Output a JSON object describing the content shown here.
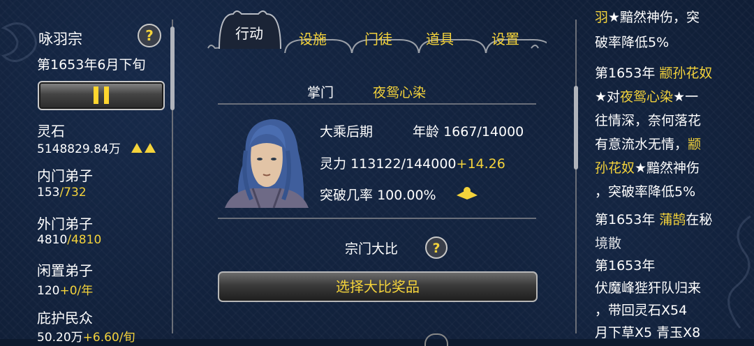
{
  "left_panel": {
    "sect_name": "咏羽宗",
    "date": "第1653年6月下旬",
    "resources": [
      {
        "label": "灵石",
        "value_main": "5148829.84万",
        "value_extra": "",
        "trend": "up-up"
      },
      {
        "label": "内门弟子",
        "value_main": "153",
        "value_extra": "/732",
        "trend": ""
      },
      {
        "label": "外门弟子",
        "value_main": "4810",
        "value_extra": "/4810",
        "trend": ""
      },
      {
        "label": "闲置弟子",
        "value_main": "120",
        "value_extra": "+0/年",
        "trend": ""
      },
      {
        "label": "庇护民众",
        "value_main": "50.20万",
        "value_extra": "+6.60/旬",
        "trend": ""
      }
    ]
  },
  "tabs": [
    {
      "label": "行动",
      "active": true
    },
    {
      "label": "设施",
      "active": false
    },
    {
      "label": "门徒",
      "active": false
    },
    {
      "label": "道具",
      "active": false
    },
    {
      "label": "设置",
      "active": false
    }
  ],
  "master": {
    "title_label": "掌门",
    "name": "夜鸳心染",
    "realm": "大乘后期",
    "age_label": "年龄",
    "age_value": "1667/14000",
    "power_label": "灵力",
    "power_value": "113122/144000",
    "power_gain": "+14.26",
    "breakthrough_label": "突破几率",
    "breakthrough_value": "100.00%"
  },
  "contest": {
    "title": "宗门大比",
    "reward_button": "选择大比奖品"
  },
  "log": {
    "top_fragment": "羽★黯然神伤，突",
    "lines": [
      [
        "破率降低5%"
      ],
      [
        "第1653年 ",
        "颛孙花奴"
      ],
      [
        "★对",
        "夜鸳心染",
        "★一"
      ],
      [
        "往情深，奈何落花"
      ],
      [
        "有意流水无情，",
        "颛"
      ],
      [
        "孙花奴",
        "★黯然神伤"
      ],
      [
        "，突破率降低5%"
      ],
      [
        "第1653年 ",
        "蒲鹄",
        "在秘"
      ],
      [
        "境散"
      ],
      [
        "第1653年"
      ],
      [
        "伏魔峰狴犴队归来"
      ],
      [
        "，带回灵石X54"
      ],
      [
        "月下草X5 青玉X8"
      ]
    ]
  },
  "colors": {
    "accent_yellow": "#f4d33b",
    "background": "#0e1b31"
  }
}
